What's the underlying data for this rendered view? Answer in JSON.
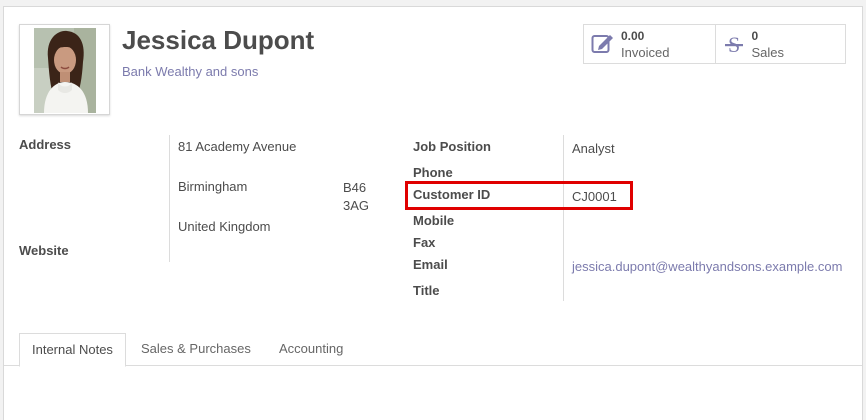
{
  "partner": {
    "name": "Jessica Dupont",
    "company": "Bank Wealthy and sons"
  },
  "stats": [
    {
      "icon": "pencil-square-icon",
      "value": "0.00",
      "label": "Invoiced"
    },
    {
      "icon": "strikethrough-s-icon",
      "value": "0",
      "label": "Sales"
    }
  ],
  "address": {
    "label": "Address",
    "street": "81 Academy Avenue",
    "city": "Birmingham",
    "zip": "B46 3AG",
    "country": "United Kingdom"
  },
  "website": {
    "label": "Website",
    "value": ""
  },
  "fields": {
    "job_position": {
      "label": "Job Position",
      "value": "Analyst"
    },
    "phone": {
      "label": "Phone",
      "value": ""
    },
    "customer_id": {
      "label": "Customer ID",
      "value": "CJ0001"
    },
    "mobile": {
      "label": "Mobile",
      "value": ""
    },
    "fax": {
      "label": "Fax",
      "value": ""
    },
    "email": {
      "label": "Email",
      "value": "jessica.dupont@wealthyandsons.example.com"
    },
    "title": {
      "label": "Title",
      "value": ""
    }
  },
  "tabs": [
    {
      "label": "Internal Notes",
      "active": true
    },
    {
      "label": "Sales & Purchases",
      "active": false
    },
    {
      "label": "Accounting",
      "active": false
    }
  ],
  "colors": {
    "accent": "#7c7bad",
    "highlight": "#e00000"
  }
}
